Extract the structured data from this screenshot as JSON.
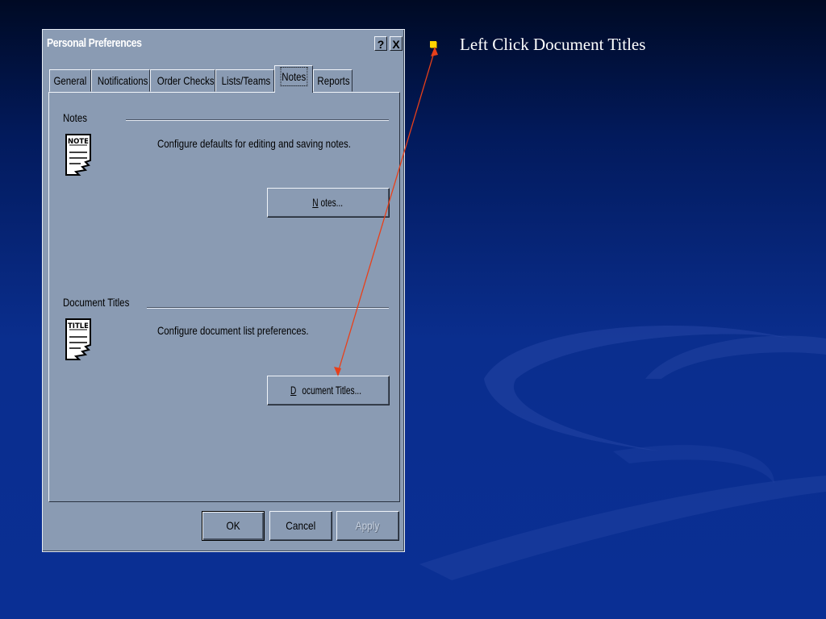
{
  "dialog": {
    "title": "Personal Preferences",
    "help_glyph": "?",
    "close_glyph": "X",
    "tabs": [
      {
        "label": "General"
      },
      {
        "label": "Notifications"
      },
      {
        "label": "Order Checks"
      },
      {
        "label": "Lists/Teams"
      },
      {
        "label": "Notes"
      },
      {
        "label": "Reports"
      }
    ],
    "active_tab": "Notes",
    "notes_section": {
      "label": "Notes",
      "icon_text": "NOTE",
      "description": "Configure defaults for editing and saving notes.",
      "button_mnemonic": "N",
      "button_rest": "otes..."
    },
    "titles_section": {
      "label": "Document Titles",
      "icon_text": "TITLE",
      "description": "Configure document list preferences.",
      "button_mnemonic": "D",
      "button_rest": "ocument Titles..."
    },
    "footer": {
      "ok": "OK",
      "cancel": "Cancel",
      "apply": "Apply"
    }
  },
  "slide": {
    "bullet_text": "Left Click Document Titles",
    "bullet_color": "#ffd400",
    "arrow_color": "#e8401a"
  }
}
